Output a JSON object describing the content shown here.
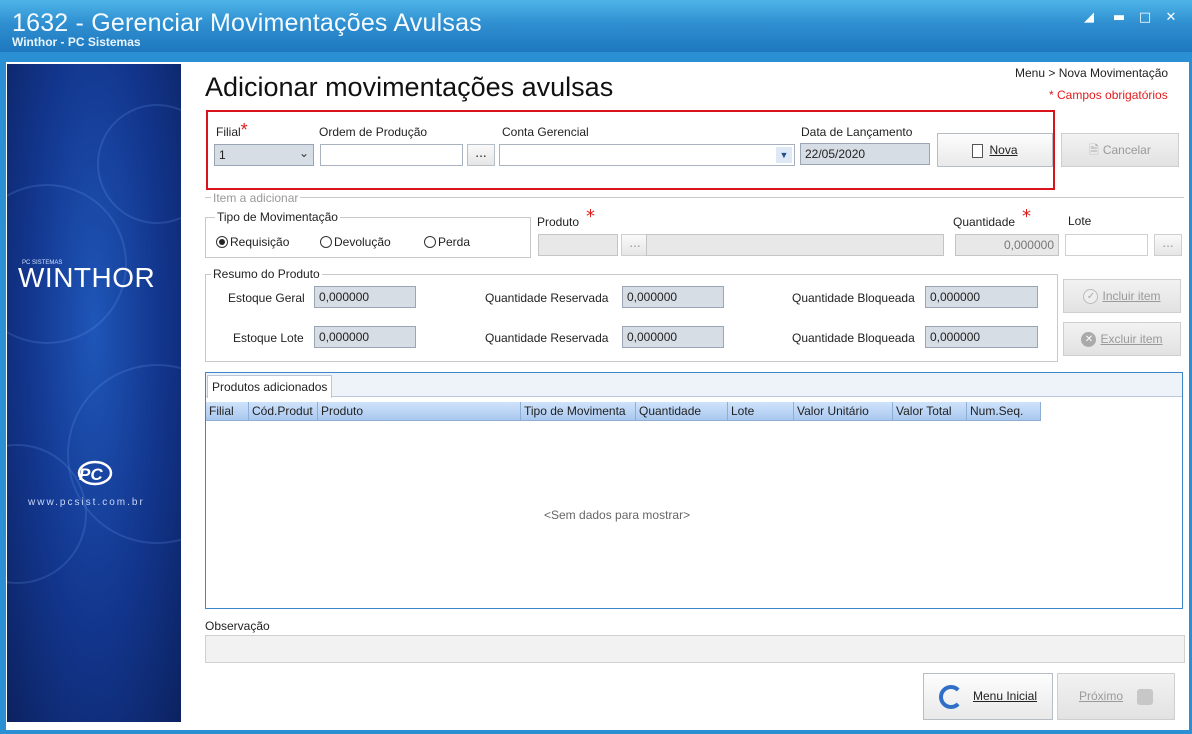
{
  "window": {
    "title": "1632 - Gerenciar Movimentações Avulsas",
    "subtitle": "Winthor - PC Sistemas"
  },
  "sidebar": {
    "brand_small": "PC SISTEMAS",
    "brand": "WINTHOR",
    "url": "www.pcsist.com.br"
  },
  "header": {
    "title": "Adicionar movimentações avulsas",
    "breadcrumb": "Menu > Nova Movimentação",
    "required_note": "* Campos obrigatórios"
  },
  "form": {
    "filial_label": "Filial",
    "filial_value": "1",
    "ordem_label": "Ordem de Produção",
    "ordem_value": "",
    "conta_label": "Conta Gerencial",
    "conta_value": "",
    "data_label": "Data de Lançamento",
    "data_value": "22/05/2020",
    "nova_label": "Nova",
    "cancelar_label": "Cancelar",
    "ellipsis": "..."
  },
  "item": {
    "legend": "Item a adicionar",
    "tipo_legend": "Tipo de Movimentação",
    "radios": [
      {
        "label": "Requisição",
        "checked": true
      },
      {
        "label": "Devolução",
        "checked": false
      },
      {
        "label": "Perda",
        "checked": false
      }
    ],
    "produto_label": "Produto",
    "quantidade_label": "Quantidade",
    "quantidade_value": "0,000000",
    "lote_label": "Lote"
  },
  "resumo": {
    "legend": "Resumo do Produto",
    "row1": {
      "estoque_label": "Estoque Geral",
      "estoque_value": "0,000000",
      "reservada_label": "Quantidade Reservada",
      "reservada_value": "0,000000",
      "bloqueada_label": "Quantidade Bloqueada",
      "bloqueada_value": "0,000000"
    },
    "row2": {
      "estoque_label": "Estoque Lote",
      "estoque_value": "0,000000",
      "reservada_label": "Quantidade Reservada",
      "reservada_value": "0,000000",
      "bloqueada_label": "Quantidade Bloqueada",
      "bloqueada_value": "0,000000"
    },
    "incluir_label": "Incluir item",
    "excluir_label": "Excluir item"
  },
  "grid": {
    "tab": "Produtos adicionados",
    "columns": [
      "Filial",
      "Cód.Produt",
      "Produto",
      "Tipo de Movimenta",
      "Quantidade",
      "Lote",
      "Valor Unitário",
      "Valor Total",
      "Num.Seq."
    ],
    "empty": "<Sem dados para mostrar>"
  },
  "observacao": {
    "label": "Observação",
    "value": ""
  },
  "footer": {
    "menu_label": "Menu Inicial",
    "proximo_label": "Próximo"
  },
  "colors": {
    "titlebar": "#2f8fd0",
    "required": "#e21b1b",
    "highlight_box": "#d9131b",
    "grid_header": "#b8d3f3"
  }
}
